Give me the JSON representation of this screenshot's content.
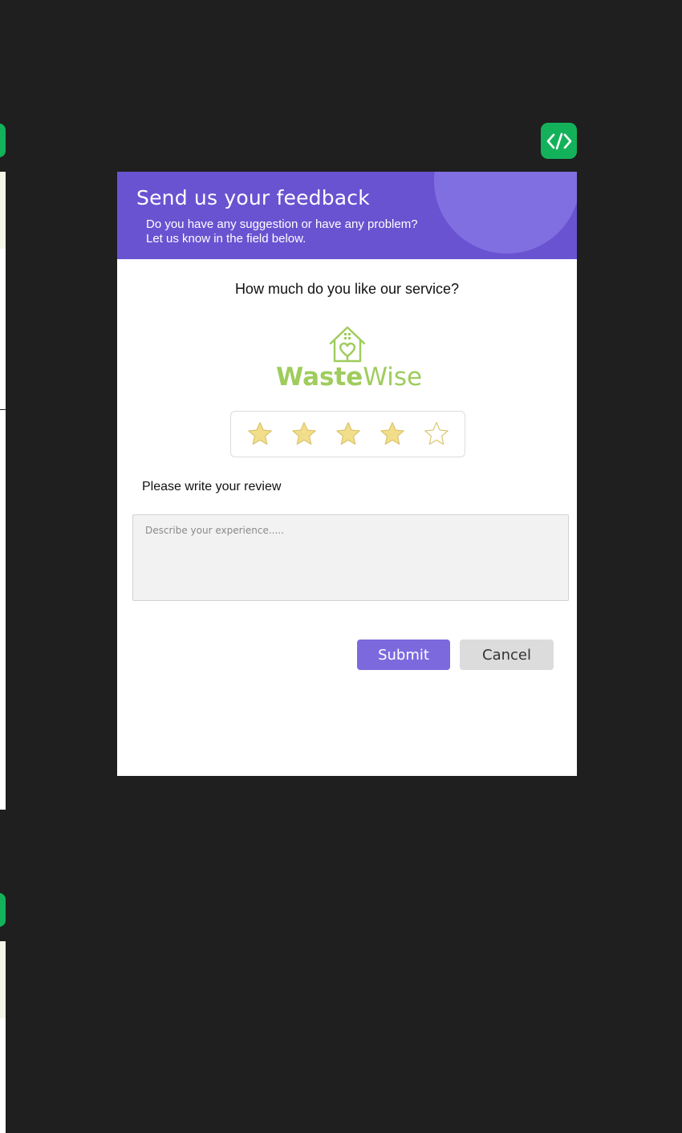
{
  "dialog": {
    "title": "Send us your feedback",
    "subtitle_line1": "Do you have any suggestion or have any problem?",
    "subtitle_line2": "Let us know in the field below.",
    "question": "How much do you like our service?",
    "logo": {
      "word_bold": "Waste",
      "word_light": "Wise",
      "icon": "house-heart-icon"
    },
    "rating": {
      "value": 4,
      "max": 5,
      "filled_color": "#f2dd8a",
      "empty_color": "#ffffff"
    },
    "review_label": "Please write your review",
    "review_placeholder": "Describe your experience.....",
    "review_value": "",
    "submit_label": "Submit",
    "cancel_label": "Cancel"
  },
  "toolbar": {
    "code_button_icon": "code-icon"
  },
  "colors": {
    "header": "#6a53d1",
    "accent": "#7d69de",
    "brand_green": "#9fcc5c",
    "code_button": "#13b25a",
    "background": "#1f1f1f"
  }
}
